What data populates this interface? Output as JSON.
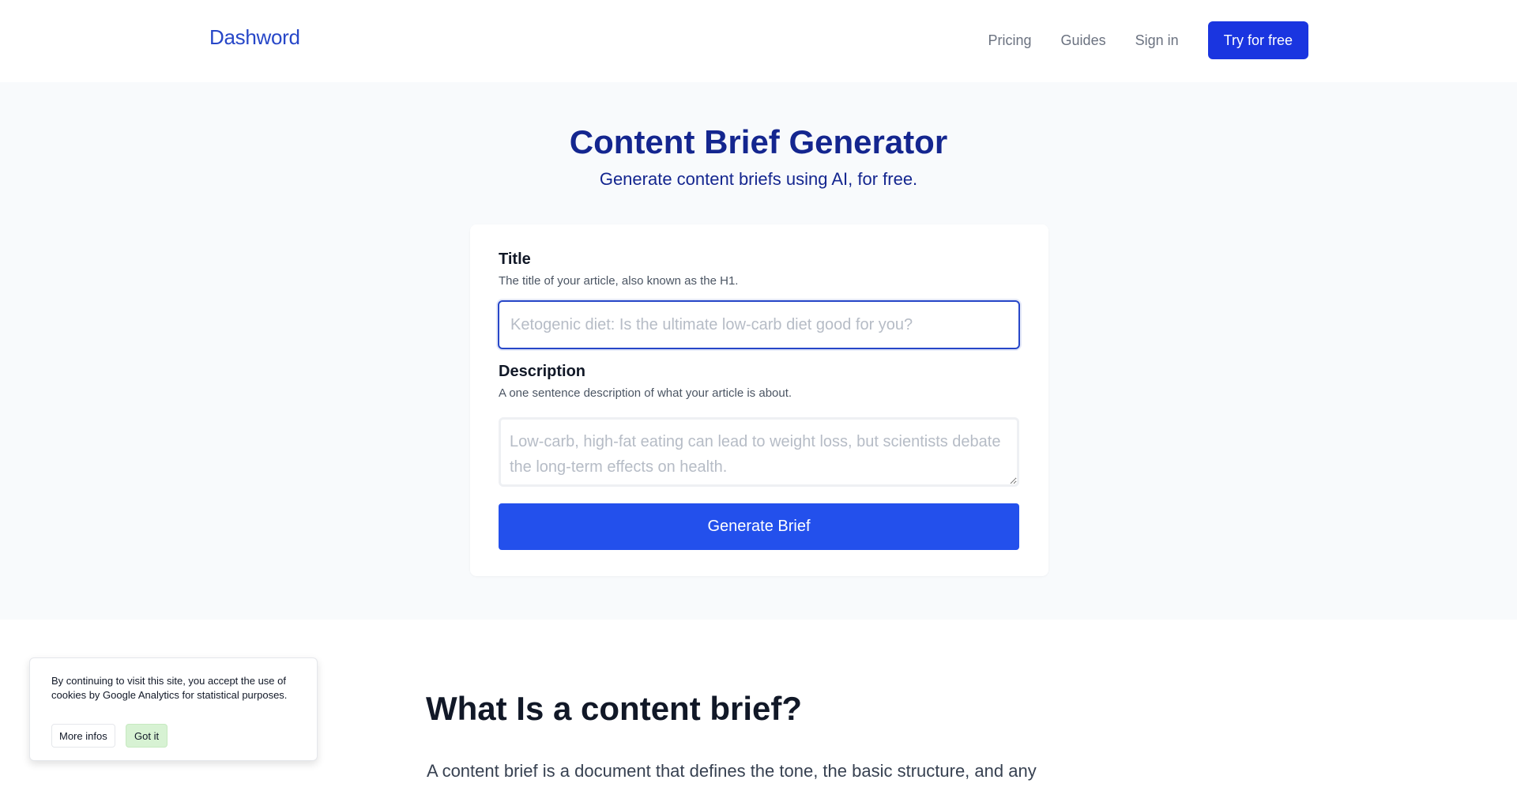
{
  "header": {
    "logo": "Dashword",
    "nav": {
      "pricing": "Pricing",
      "guides": "Guides",
      "sign_in": "Sign in",
      "cta": "Try for free"
    }
  },
  "hero": {
    "title": "Content Brief Generator",
    "subtitle": "Generate content briefs using AI, for free."
  },
  "form": {
    "title_label": "Title",
    "title_help": "The title of your article, also known as the H1.",
    "title_value": "",
    "title_placeholder": "Ketogenic diet: Is the ultimate low-carb diet good for you?",
    "description_label": "Description",
    "description_help": "A one sentence description of what your article is about.",
    "description_value": "",
    "description_placeholder": "Low-carb, high-fat eating can lead to weight loss, but scientists debate the long-term effects on health.",
    "submit_label": "Generate Brief"
  },
  "article": {
    "heading": "What Is a content brief?",
    "body_first_line": "A content brief is a document that defines the tone, the basic structure, and any"
  },
  "cookie_banner": {
    "text": "By continuing to visit this site, you accept the use of cookies by Google Analytics for statistical purposes.",
    "more_label": "More infos",
    "accept_label": "Got it"
  },
  "colors": {
    "brand": "#2747c8",
    "cta": "#1a35e0",
    "primary_button": "#2350ec",
    "heading_navy": "#14268f",
    "hero_background": "#f8fafc",
    "cookie_accept": "#d7f2d3"
  }
}
